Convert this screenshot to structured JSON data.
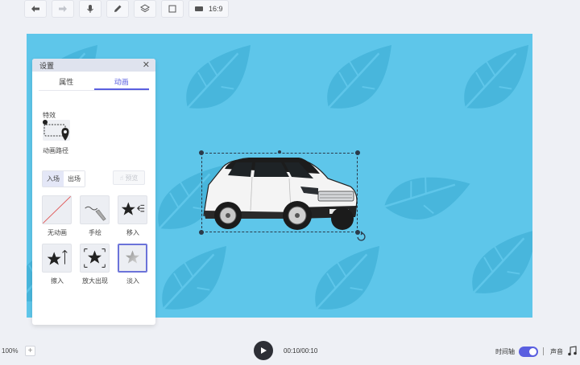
{
  "toolbar": {
    "buttons": [
      {
        "icon": "undo-icon"
      },
      {
        "icon": "redo-icon"
      },
      {
        "icon": "microphone-icon"
      },
      {
        "icon": "pencil-icon"
      },
      {
        "icon": "layers-icon"
      },
      {
        "icon": "frame-icon"
      }
    ],
    "ratio_label": "16:9"
  },
  "panel": {
    "title": "设置",
    "tabs": [
      "属性",
      "动画"
    ],
    "active_tab": "动画",
    "effect_label": "特效",
    "effect_name": "动画路径",
    "segments": [
      "入场",
      "出场"
    ],
    "active_segment": "入场",
    "preview_label": "预览",
    "animations": [
      {
        "label": "无动画",
        "icon": "no-animation-icon"
      },
      {
        "label": "手绘",
        "icon": "hand-draw-icon"
      },
      {
        "label": "移入",
        "icon": "move-in-icon"
      },
      {
        "label": "擦入",
        "icon": "wipe-in-icon"
      },
      {
        "label": "放大出现",
        "icon": "zoom-appear-icon"
      },
      {
        "label": "淡入",
        "icon": "fade-in-icon",
        "selected": true
      }
    ]
  },
  "bottom": {
    "zoom": "100%",
    "time": "00:10/00:10",
    "timeline_label": "时间轴",
    "timeline_on": true,
    "sound_label": "声音"
  },
  "colors": {
    "canvas_bg": "#5ec6ea",
    "accent": "#5a5fe0"
  }
}
